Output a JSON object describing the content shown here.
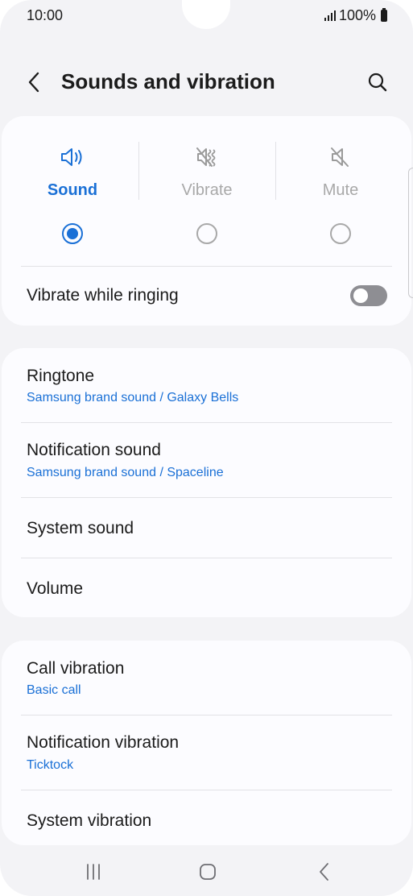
{
  "status_bar": {
    "time": "10:00",
    "battery_text": "100%",
    "icons": [
      "signal-icon",
      "battery-icon"
    ]
  },
  "header": {
    "title": "Sounds and vibration",
    "back_icon": "chevron-left-icon",
    "search_icon": "search-icon"
  },
  "sound_mode": {
    "options": [
      {
        "label": "Sound",
        "icon": "speaker-icon",
        "selected": true
      },
      {
        "label": "Vibrate",
        "icon": "vibrate-icon",
        "selected": false
      },
      {
        "label": "Mute",
        "icon": "mute-icon",
        "selected": false
      }
    ],
    "accent_color": "#1a70d6"
  },
  "vibrate_while_ringing": {
    "label": "Vibrate while ringing",
    "enabled": false
  },
  "sounds": [
    {
      "title": "Ringtone",
      "subtitle": "Samsung brand sound / Galaxy Bells"
    },
    {
      "title": "Notification sound",
      "subtitle": "Samsung brand sound / Spaceline"
    },
    {
      "title": "System sound"
    },
    {
      "title": "Volume"
    }
  ],
  "vibrations": [
    {
      "title": "Call vibration",
      "subtitle": "Basic call"
    },
    {
      "title": "Notification vibration",
      "subtitle": "Ticktock"
    },
    {
      "title": "System vibration"
    }
  ],
  "nav_bar": {
    "icons": [
      "recent-apps-icon",
      "home-icon",
      "back-icon"
    ]
  }
}
